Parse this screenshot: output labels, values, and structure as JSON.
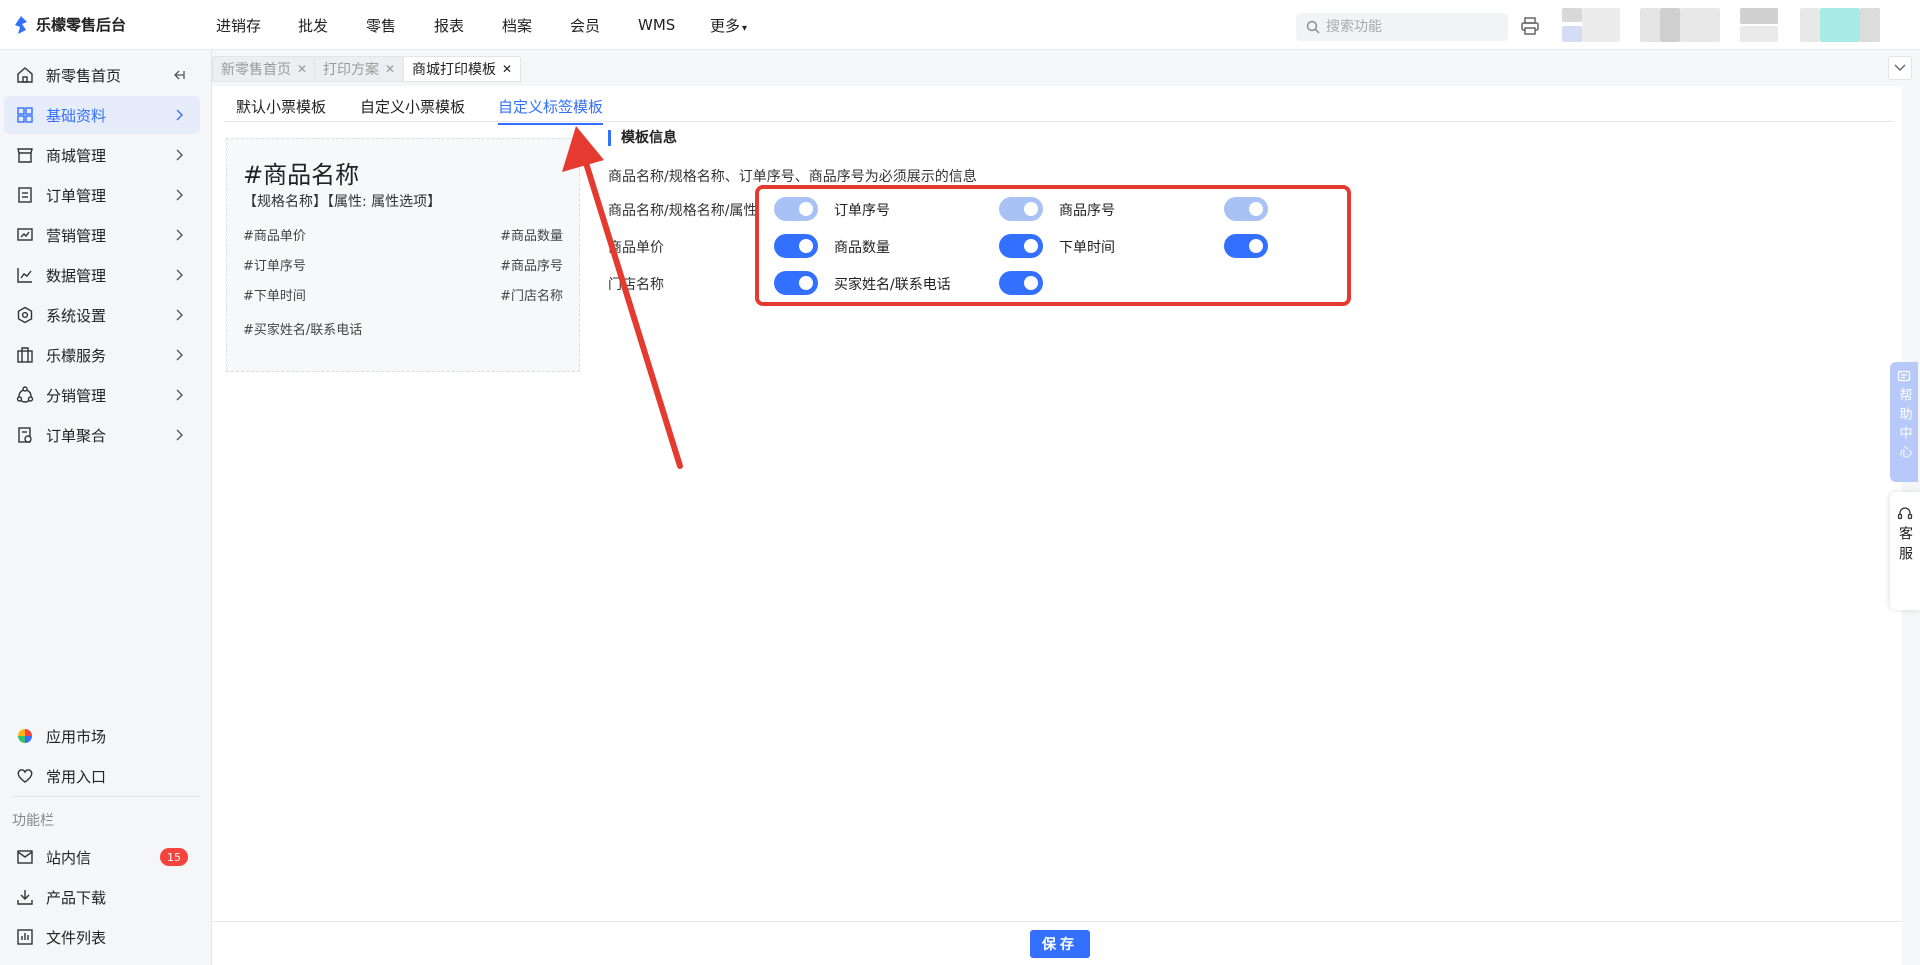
{
  "brand": {
    "title": "乐檬零售后台"
  },
  "topnav": [
    {
      "label": "进销存"
    },
    {
      "label": "批发"
    },
    {
      "label": "零售"
    },
    {
      "label": "报表"
    },
    {
      "label": "档案"
    },
    {
      "label": "会员"
    },
    {
      "label": "WMS"
    },
    {
      "label": "更多"
    }
  ],
  "search": {
    "placeholder": "搜索功能"
  },
  "sidebar": {
    "items": [
      {
        "label": "新零售首页",
        "icon": "home-icon"
      },
      {
        "label": "基础资料",
        "icon": "grid-icon",
        "active": true
      },
      {
        "label": "商城管理",
        "icon": "store-icon"
      },
      {
        "label": "订单管理",
        "icon": "order-icon"
      },
      {
        "label": "营销管理",
        "icon": "marketing-icon"
      },
      {
        "label": "数据管理",
        "icon": "chart-icon"
      },
      {
        "label": "系统设置",
        "icon": "settings-icon"
      },
      {
        "label": "乐檬服务",
        "icon": "briefcase-icon"
      },
      {
        "label": "分销管理",
        "icon": "distribution-icon"
      },
      {
        "label": "订单聚合",
        "icon": "aggregate-icon"
      }
    ],
    "bottom": [
      {
        "label": "应用市场",
        "icon": "app-market-icon"
      },
      {
        "label": "常用入口",
        "icon": "heart-icon"
      }
    ],
    "section_label": "功能栏",
    "tools": [
      {
        "label": "站内信",
        "icon": "mail-icon",
        "badge": "15"
      },
      {
        "label": "产品下载",
        "icon": "download-icon"
      },
      {
        "label": "文件列表",
        "icon": "file-list-icon"
      }
    ]
  },
  "tabs": [
    {
      "label": "新零售首页"
    },
    {
      "label": "打印方案"
    },
    {
      "label": "商城打印模板",
      "active": true
    }
  ],
  "subtabs": [
    {
      "label": "默认小票模板"
    },
    {
      "label": "自定义小票模板"
    },
    {
      "label": "自定义标签模板",
      "active": true
    }
  ],
  "preview": {
    "title": "#商品名称",
    "spec": "【规格名称】【属性: 属性选项】",
    "fields": {
      "unit_price": "#商品单价",
      "quantity": "#商品数量",
      "order_seq": "#订单序号",
      "goods_seq": "#商品序号",
      "order_time": "#下单时间",
      "store_name": "#门店名称",
      "buyer": "#买家姓名/联系电话"
    }
  },
  "template_info": {
    "title": "模板信息",
    "description": "商品名称/规格名称、订单序号、商品序号为必须展示的信息",
    "rows": [
      {
        "label": "商品名称/规格名称/属性",
        "toggles": [
          {
            "label": "订单序号",
            "on": true,
            "disabled": true
          },
          {
            "label": "商品序号",
            "on": true,
            "disabled": true
          }
        ],
        "lead_toggle": {
          "on": true,
          "disabled": true
        }
      },
      {
        "label": "商品单价",
        "toggles": [
          {
            "label": "商品数量",
            "on": true,
            "disabled": false
          },
          {
            "label": "下单时间",
            "on": true,
            "disabled": false
          }
        ],
        "lead_toggle": {
          "on": true,
          "disabled": false
        }
      },
      {
        "label": "门店名称",
        "toggles": [
          {
            "label": "买家姓名/联系电话",
            "on": true,
            "disabled": false
          }
        ],
        "lead_toggle": {
          "on": true,
          "disabled": false
        }
      }
    ]
  },
  "footer": {
    "save_label": "保存"
  },
  "float": {
    "help_label": "帮助中心",
    "service_label": "客服"
  },
  "colors": {
    "accent": "#3370ff",
    "toggle_disabled": "#a9c2f5",
    "annotation": "#e53a2f",
    "badge": "#f5433d"
  }
}
